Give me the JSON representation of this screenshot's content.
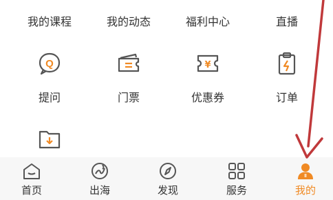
{
  "top_links": [
    "我的课程",
    "我的动态",
    "福利中心",
    "直播"
  ],
  "grid": [
    {
      "label": "提问",
      "icon": "question-bubble-icon"
    },
    {
      "label": "门票",
      "icon": "ticket-icon"
    },
    {
      "label": "优惠券",
      "icon": "coupon-icon"
    },
    {
      "label": "订单",
      "icon": "order-clipboard-icon"
    },
    {
      "label": "",
      "icon": "folder-download-icon"
    }
  ],
  "tabs": [
    {
      "label": "首页",
      "icon": "home-icon"
    },
    {
      "label": "出海",
      "icon": "globe-icon"
    },
    {
      "label": "发现",
      "icon": "compass-icon"
    },
    {
      "label": "服务",
      "icon": "grid-icon"
    },
    {
      "label": "我的",
      "icon": "user-icon",
      "active": true
    }
  ],
  "colors": {
    "accent": "#f08a24",
    "icon_stroke": "#555555",
    "arrow": "#c0393b",
    "tabbar_bg": "#f7f7f7"
  }
}
